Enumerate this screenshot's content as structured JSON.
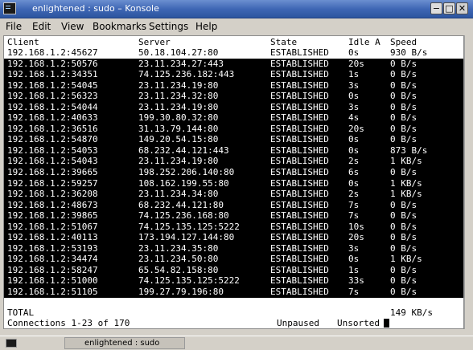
{
  "window": {
    "title": "enlightened : sudo – Konsole",
    "minimize_glyph": "−",
    "maximize_glyph": "□",
    "close_glyph": "✕"
  },
  "menu": {
    "file": "File",
    "edit": "Edit",
    "view": "View",
    "bookmarks": "Bookmarks",
    "settings": "Settings",
    "help": "Help"
  },
  "table": {
    "headers": {
      "client": "Client",
      "server": "Server",
      "state": "State",
      "idle": "Idle A",
      "speed": "Speed"
    },
    "rows": [
      {
        "client": "192.168.1.2:45627",
        "server": "50.18.104.27:80",
        "state": "ESTABLISHED",
        "idle": "0s",
        "speed": "930 B/s",
        "selected": true
      },
      {
        "client": "192.168.1.2:50576",
        "server": "23.11.234.27:443",
        "state": "ESTABLISHED",
        "idle": "20s",
        "speed": "0 B/s"
      },
      {
        "client": "192.168.1.2:34351",
        "server": "74.125.236.182:443",
        "state": "ESTABLISHED",
        "idle": "1s",
        "speed": "0 B/s"
      },
      {
        "client": "192.168.1.2:54045",
        "server": "23.11.234.19:80",
        "state": "ESTABLISHED",
        "idle": "3s",
        "speed": "0 B/s"
      },
      {
        "client": "192.168.1.2:56323",
        "server": "23.11.234.32:80",
        "state": "ESTABLISHED",
        "idle": "0s",
        "speed": "0 B/s"
      },
      {
        "client": "192.168.1.2:54044",
        "server": "23.11.234.19:80",
        "state": "ESTABLISHED",
        "idle": "3s",
        "speed": "0 B/s"
      },
      {
        "client": "192.168.1.2:40633",
        "server": "199.30.80.32:80",
        "state": "ESTABLISHED",
        "idle": "4s",
        "speed": "0 B/s"
      },
      {
        "client": "192.168.1.2:36516",
        "server": "31.13.79.144:80",
        "state": "ESTABLISHED",
        "idle": "20s",
        "speed": "0 B/s"
      },
      {
        "client": "192.168.1.2:54870",
        "server": "149.20.54.15:80",
        "state": "ESTABLISHED",
        "idle": "0s",
        "speed": "0 B/s"
      },
      {
        "client": "192.168.1.2:54053",
        "server": "68.232.44.121:443",
        "state": "ESTABLISHED",
        "idle": "0s",
        "speed": "873 B/s"
      },
      {
        "client": "192.168.1.2:54043",
        "server": "23.11.234.19:80",
        "state": "ESTABLISHED",
        "idle": "2s",
        "speed": "1 KB/s"
      },
      {
        "client": "192.168.1.2:39665",
        "server": "198.252.206.140:80",
        "state": "ESTABLISHED",
        "idle": "6s",
        "speed": "0 B/s"
      },
      {
        "client": "192.168.1.2:59257",
        "server": "108.162.199.55:80",
        "state": "ESTABLISHED",
        "idle": "0s",
        "speed": "1 KB/s"
      },
      {
        "client": "192.168.1.2:36208",
        "server": "23.11.234.34:80",
        "state": "ESTABLISHED",
        "idle": "2s",
        "speed": "1 KB/s"
      },
      {
        "client": "192.168.1.2:48673",
        "server": "68.232.44.121:80",
        "state": "ESTABLISHED",
        "idle": "7s",
        "speed": "0 B/s"
      },
      {
        "client": "192.168.1.2:39865",
        "server": "74.125.236.168:80",
        "state": "ESTABLISHED",
        "idle": "7s",
        "speed": "0 B/s"
      },
      {
        "client": "192.168.1.2:51067",
        "server": "74.125.135.125:5222",
        "state": "ESTABLISHED",
        "idle": "10s",
        "speed": "0 B/s"
      },
      {
        "client": "192.168.1.2:40113",
        "server": "173.194.127.144:80",
        "state": "ESTABLISHED",
        "idle": "20s",
        "speed": "0 B/s"
      },
      {
        "client": "192.168.1.2:53193",
        "server": "23.11.234.35:80",
        "state": "ESTABLISHED",
        "idle": "3s",
        "speed": "0 B/s"
      },
      {
        "client": "192.168.1.2:34474",
        "server": "23.11.234.50:80",
        "state": "ESTABLISHED",
        "idle": "0s",
        "speed": "1 KB/s"
      },
      {
        "client": "192.168.1.2:58247",
        "server": "65.54.82.158:80",
        "state": "ESTABLISHED",
        "idle": "1s",
        "speed": "0 B/s"
      },
      {
        "client": "192.168.1.2:51000",
        "server": "74.125.135.125:5222",
        "state": "ESTABLISHED",
        "idle": "33s",
        "speed": "0 B/s"
      },
      {
        "client": "192.168.1.2:51105",
        "server": "199.27.79.196:80",
        "state": "ESTABLISHED",
        "idle": "7s",
        "speed": "0 B/s"
      }
    ],
    "total_label": "TOTAL",
    "total_speed": "149 KB/s"
  },
  "status": {
    "connections": "Connections 1-23 of 170",
    "paused": "Unpaused",
    "sorted": "Unsorted"
  },
  "taskbar": {
    "task_label": "enlightened : sudo"
  },
  "colors": {
    "titlebar": "#3f67b5",
    "terminal_bg": "#000000",
    "terminal_fg": "#ffffff",
    "chrome": "#d4d0c8"
  }
}
